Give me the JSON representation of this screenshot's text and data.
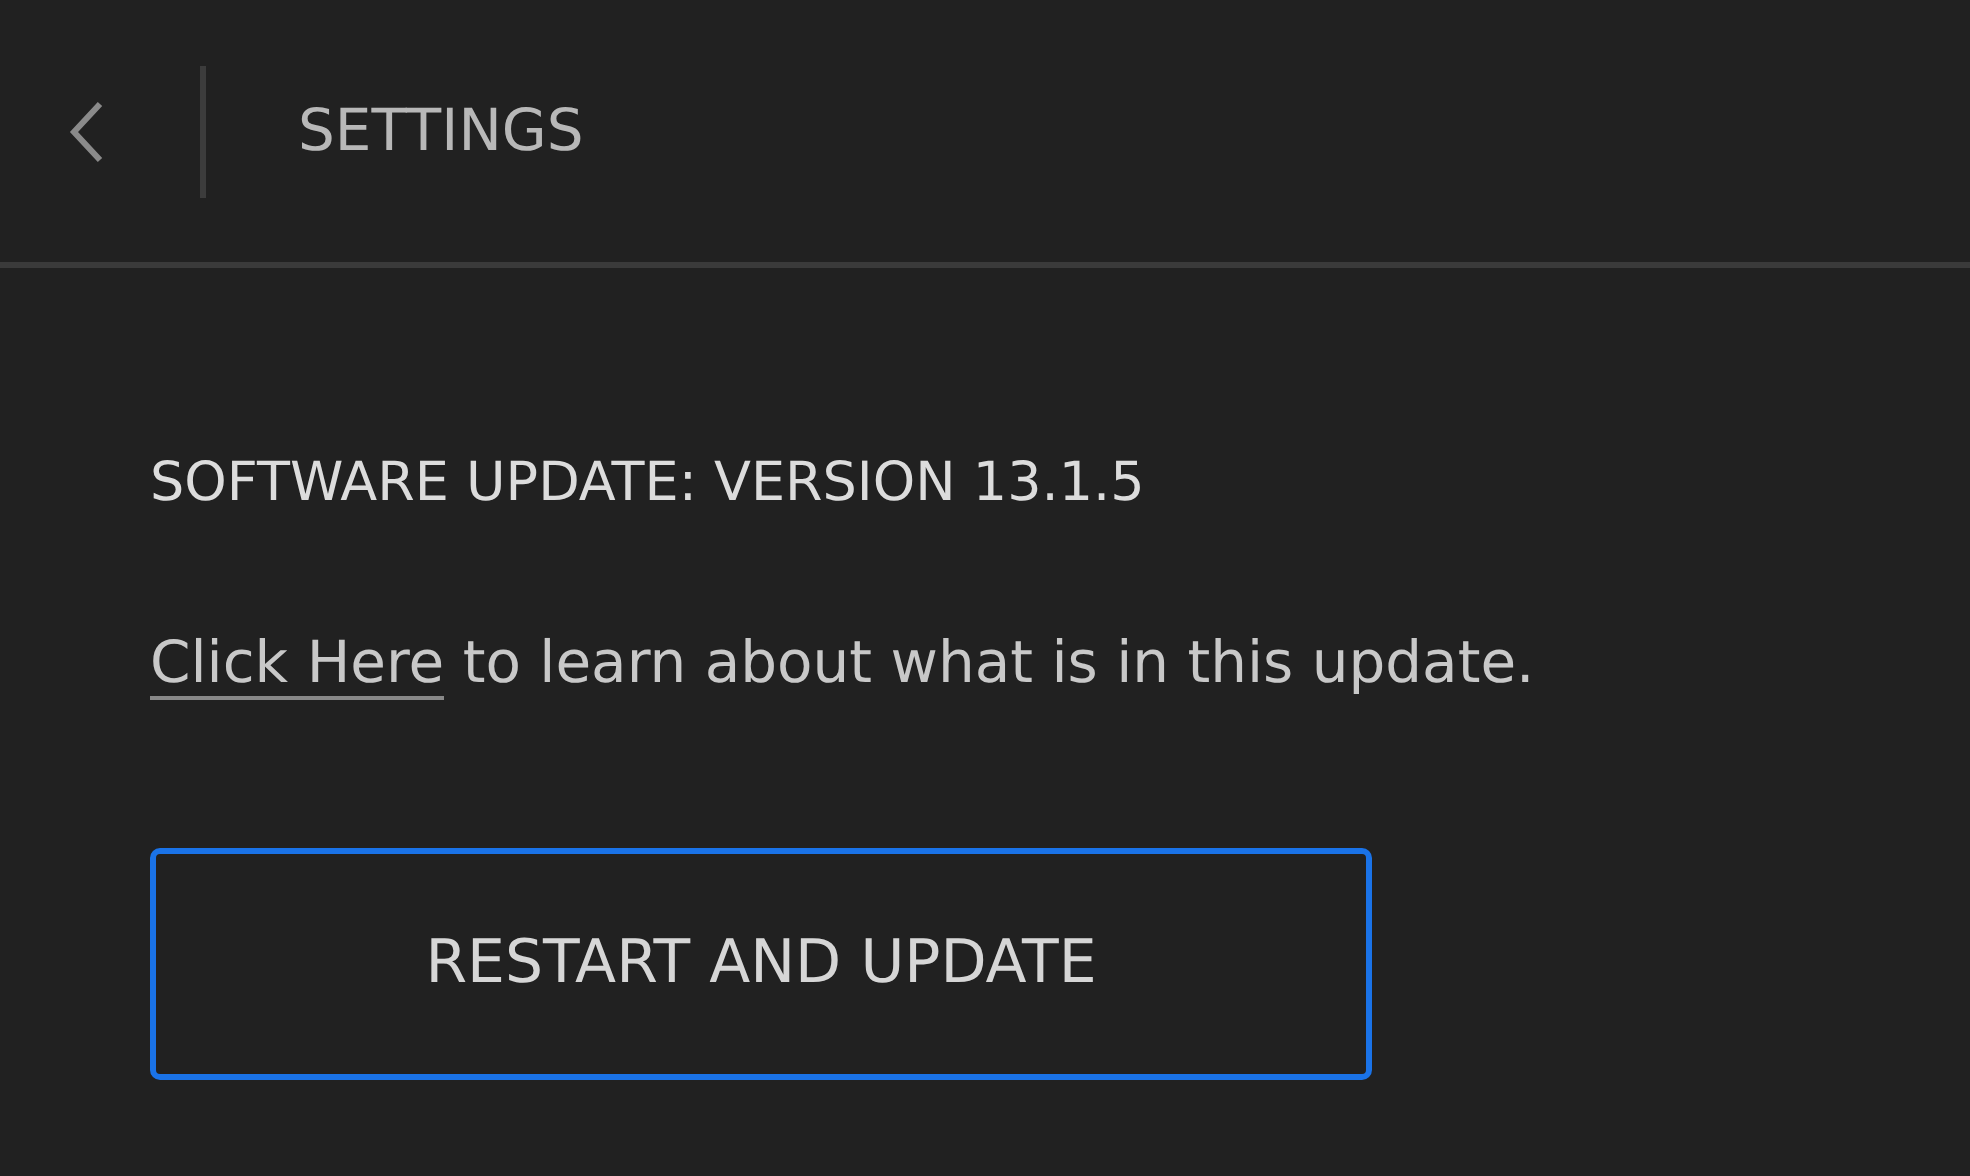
{
  "header": {
    "title": "SETTINGS"
  },
  "update": {
    "title": "SOFTWARE UPDATE: VERSION 13.1.5",
    "link": "Click Here",
    "text": " to learn about what is in this update.",
    "button": "RESTART AND UPDATE"
  }
}
